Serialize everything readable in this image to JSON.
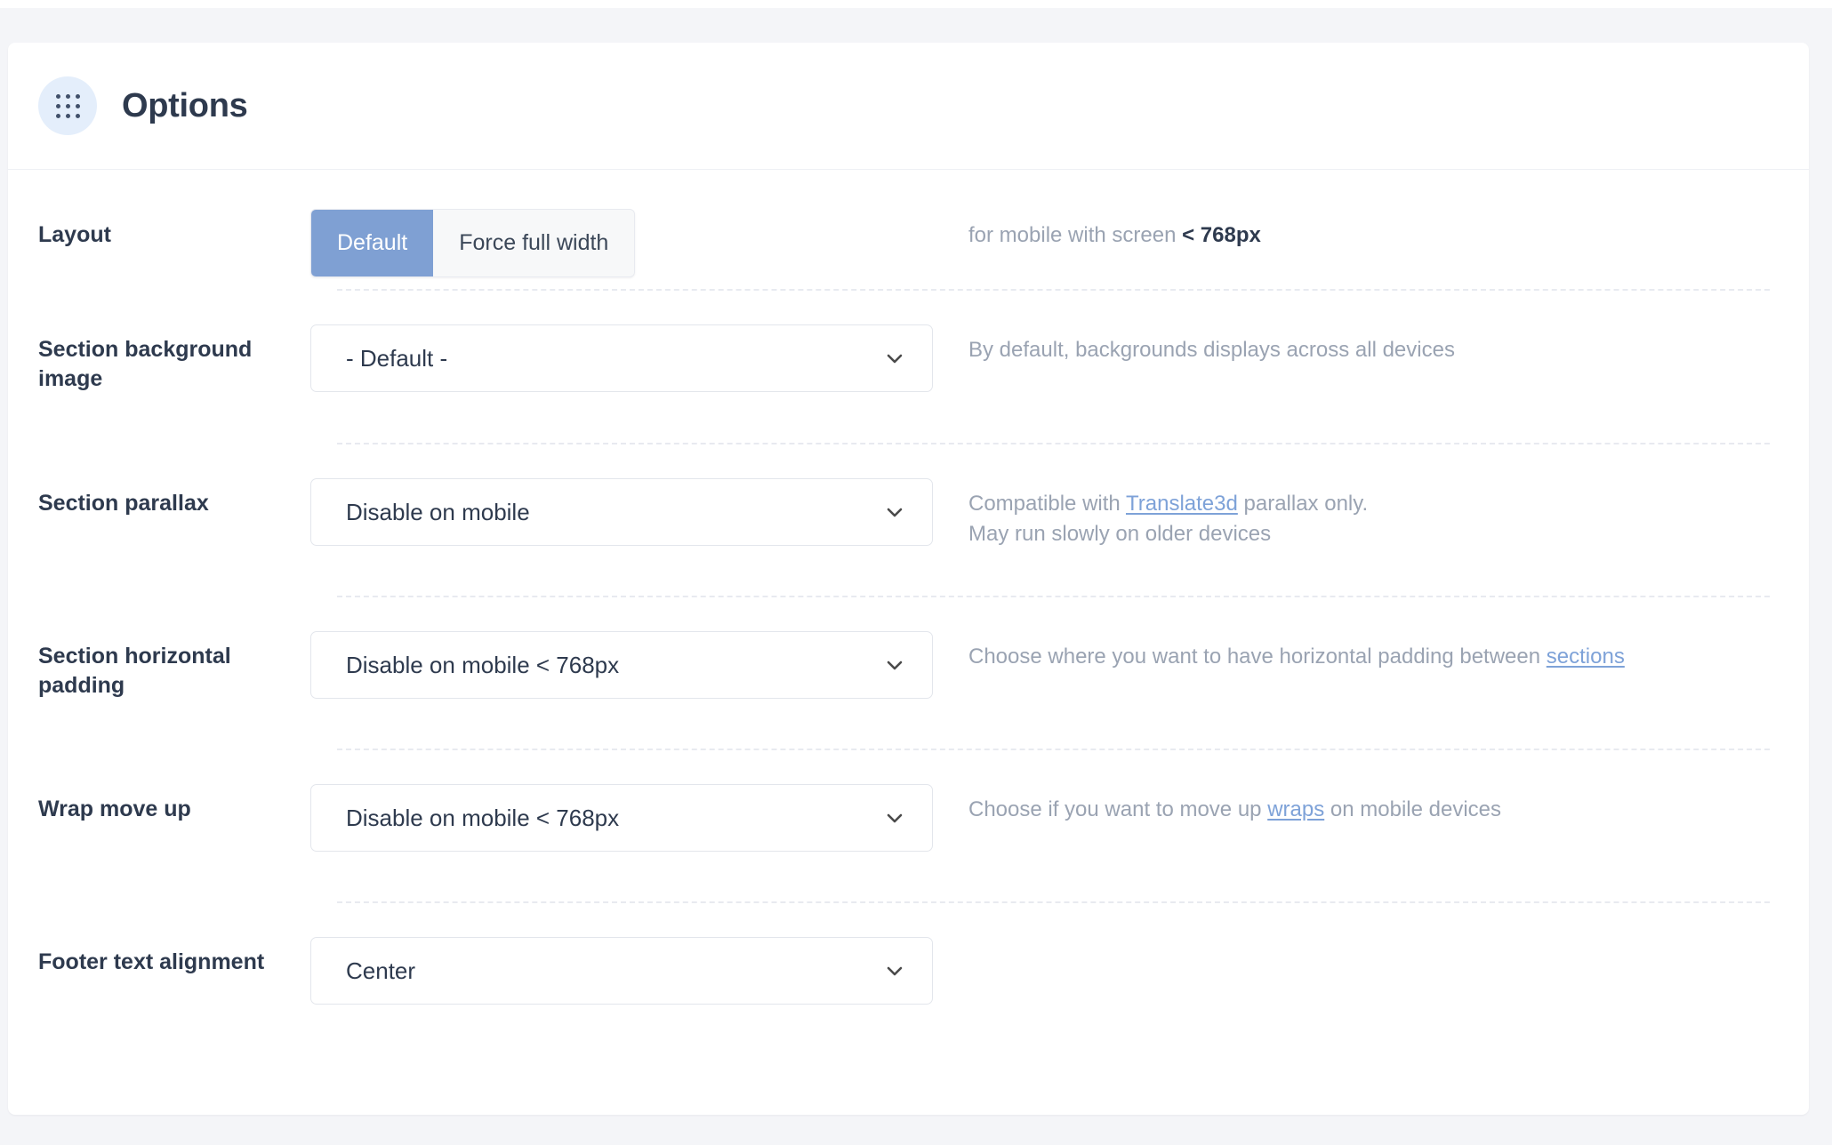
{
  "header": {
    "title": "Options",
    "icon": "grid-dots-icon"
  },
  "colors": {
    "page_background": "#f4f5f8",
    "card_background": "#ffffff",
    "accent_active_segment": "#7fa0d3",
    "icon_circle": "#e4eefb",
    "label_text": "#2e3a4e",
    "help_text": "#9aa3b2",
    "link": "#7ea2d8",
    "border": "#e3e6ec"
  },
  "rows": [
    {
      "label": "Layout",
      "control_type": "segmented",
      "options": [
        "Default",
        "Force full width"
      ],
      "selected": "Default",
      "help_prefix": "for mobile with screen ",
      "help_strong": "< 768px",
      "help_suffix": ""
    },
    {
      "label": "Section background image",
      "control_type": "select",
      "value": "- Default -",
      "help": "By default, backgrounds displays across all devices"
    },
    {
      "label": "Section parallax",
      "control_type": "select",
      "value": "Disable on mobile",
      "help_line1_prefix": "Compatible with ",
      "help_line1_link": "Translate3d",
      "help_line1_suffix": " parallax only.",
      "help_line2": "May run slowly on older devices"
    },
    {
      "label": "Section horizontal padding",
      "control_type": "select",
      "value": "Disable on mobile < 768px",
      "help_prefix": "Choose where you want to have horizontal padding between ",
      "help_link": "sections",
      "help_suffix": ""
    },
    {
      "label": "Wrap move up",
      "control_type": "select",
      "value": "Disable on mobile < 768px",
      "help_prefix": "Choose if you want to move up ",
      "help_link": "wraps",
      "help_suffix": " on mobile devices"
    },
    {
      "label": "Footer text alignment",
      "control_type": "select",
      "value": "Center",
      "help": ""
    }
  ]
}
